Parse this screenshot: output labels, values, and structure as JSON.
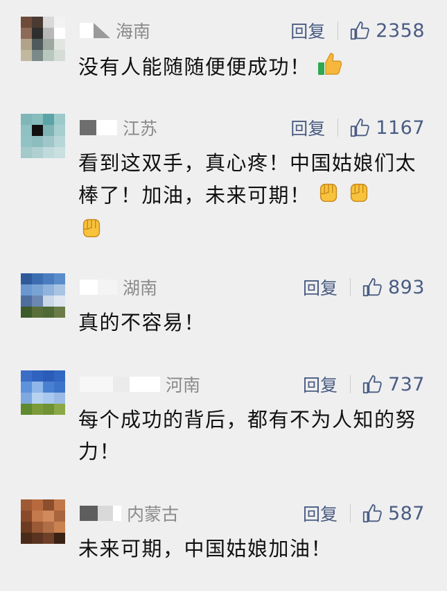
{
  "comments": [
    {
      "region": "海南",
      "reply_label": "回复",
      "likes": "2358",
      "text": "没有人能随随便便成功！",
      "emoji": [
        "thumbs-up-icon"
      ],
      "avatar_colors": [
        "#6e4b3b",
        "#4a3a32",
        "#d9d9d9",
        "#f2f2f2",
        "#8c6b58",
        "#2e2e2e",
        "#b8b8b8",
        "#ffffff",
        "#b0a38a",
        "#4f5a5c",
        "#9fa7a3",
        "#e2e6e1",
        "#c2b8a0",
        "#7b8a88",
        "#b8c8bf",
        "#d6ddd8"
      ]
    },
    {
      "region": "江苏",
      "reply_label": "回复",
      "likes": "1167",
      "text": "看到这双手，真心疼！中国姑娘们太棒了！加油，未来可期！",
      "emoji": [
        "fist-icon",
        "fist-icon",
        "fist-icon"
      ],
      "avatar_colors": [
        "#7fb7b8",
        "#86bdbd",
        "#5aa3a6",
        "#9ccaca",
        "#8fc1c2",
        "#111111",
        "#7eb4b5",
        "#a7cfcf",
        "#92c3c4",
        "#8dbdbe",
        "#9fc6c8",
        "#b7d6d7",
        "#a4c9ca",
        "#b0cfd0",
        "#c0dadb",
        "#c9dfe0"
      ]
    },
    {
      "region": "湖南",
      "reply_label": "回复",
      "likes": "893",
      "text": "真的不容易！",
      "emoji": [],
      "avatar_colors": [
        "#2f5a9a",
        "#3c6db0",
        "#4a7cc0",
        "#5a8ccc",
        "#6a97cf",
        "#7aa3d5",
        "#8fb3dc",
        "#a8c4e3",
        "#4d6e9e",
        "#6c88b2",
        "#c9d7e8",
        "#dfe6ef",
        "#3d5a2a",
        "#5a6e3a",
        "#4f6a36",
        "#6b7c48"
      ]
    },
    {
      "region": "河南",
      "reply_label": "回复",
      "likes": "737",
      "text": "每个成功的背后，都有不为人知的努力！",
      "emoji": [],
      "avatar_colors": [
        "#3a6ec7",
        "#2f63bf",
        "#2a5cb8",
        "#3166c2",
        "#5f92dc",
        "#8fb7ea",
        "#4a80d2",
        "#3d74cb",
        "#7fa8e0",
        "#b7d2f0",
        "#a9c8ee",
        "#9bbbe6",
        "#5f8a2f",
        "#7c9a3a",
        "#6f9334",
        "#8aa845"
      ]
    },
    {
      "region": "内蒙古",
      "reply_label": "回复",
      "likes": "587",
      "text": "未来可期，中国姑娘加油！",
      "emoji": [],
      "avatar_colors": [
        "#a05a33",
        "#b86a3e",
        "#8c4e2c",
        "#c2774a",
        "#8a4a2a",
        "#c47a4c",
        "#d08a5c",
        "#a9653d",
        "#6e3a20",
        "#9a5a36",
        "#b06e46",
        "#c98250",
        "#4a2a18",
        "#5a3420",
        "#6e4028",
        "#3a2214"
      ]
    }
  ]
}
